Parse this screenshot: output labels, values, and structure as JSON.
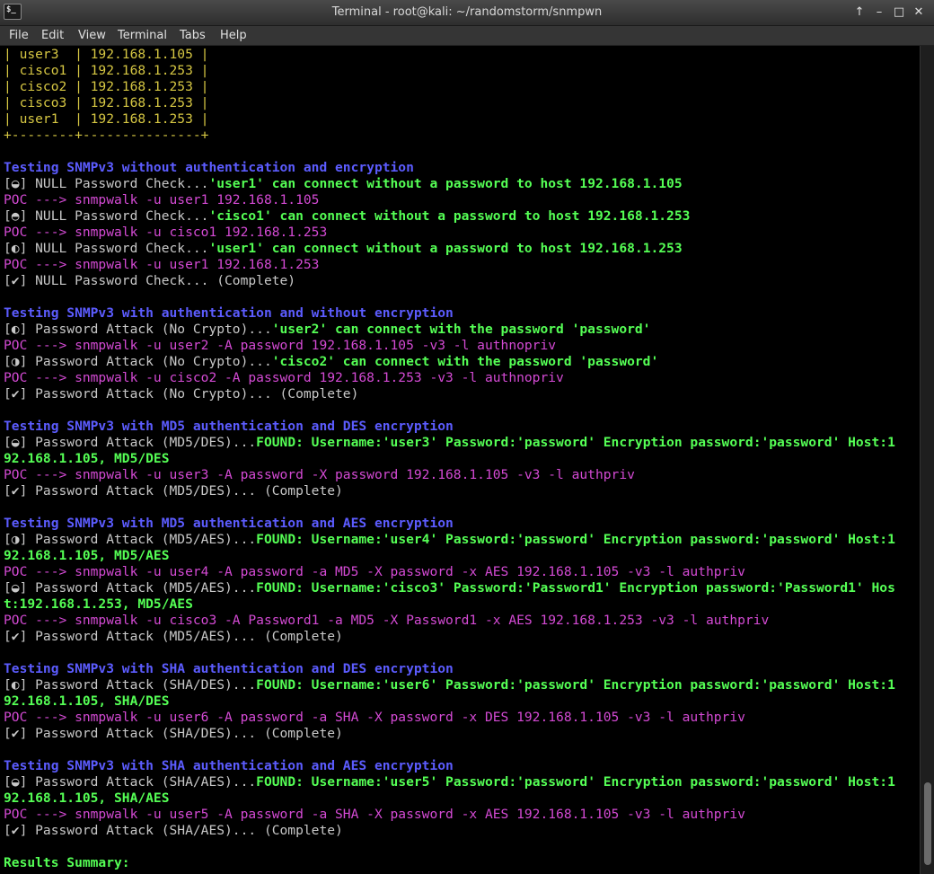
{
  "window": {
    "title": "Terminal - root@kali: ~/randomstorm/snmpwn",
    "icon_label": "$_",
    "buttons": {
      "up": "↑",
      "minimize": "–",
      "maximize": "□",
      "close": "✕"
    }
  },
  "menu": [
    "File",
    "Edit",
    "View",
    "Terminal",
    "Tabs",
    "Help"
  ],
  "terminal": {
    "lines": [
      [
        {
          "t": "| user3  | 192.168.1.105 |",
          "c": "y"
        }
      ],
      [
        {
          "t": "| cisco1 | 192.168.1.253 |",
          "c": "y"
        }
      ],
      [
        {
          "t": "| cisco2 | 192.168.1.253 |",
          "c": "y"
        }
      ],
      [
        {
          "t": "| cisco3 | 192.168.1.253 |",
          "c": "y"
        }
      ],
      [
        {
          "t": "| user1  | 192.168.1.253 |",
          "c": "y"
        }
      ],
      [
        {
          "t": "+--------+---------------+",
          "c": "y"
        }
      ],
      [],
      [
        {
          "t": "Testing SNMPv3 without authentication and encryption",
          "c": "b"
        }
      ],
      [
        {
          "t": "[◒] NULL Password Check...",
          "c": "w"
        },
        {
          "t": "'user1' can connect without a password to host 192.168.1.105",
          "c": "g"
        }
      ],
      [
        {
          "t": "POC ---> snmpwalk -u user1 192.168.1.105",
          "c": "m"
        }
      ],
      [
        {
          "t": "[◓] NULL Password Check...",
          "c": "w"
        },
        {
          "t": "'cisco1' can connect without a password to host 192.168.1.253",
          "c": "g"
        }
      ],
      [
        {
          "t": "POC ---> snmpwalk -u cisco1 192.168.1.253",
          "c": "m"
        }
      ],
      [
        {
          "t": "[◐] NULL Password Check...",
          "c": "w"
        },
        {
          "t": "'user1' can connect without a password to host 192.168.1.253",
          "c": "g"
        }
      ],
      [
        {
          "t": "POC ---> snmpwalk -u user1 192.168.1.253",
          "c": "m"
        }
      ],
      [
        {
          "t": "[✔] NULL Password Check... (Complete)",
          "c": "w"
        }
      ],
      [],
      [
        {
          "t": "Testing SNMPv3 with authentication and without encryption",
          "c": "b"
        }
      ],
      [
        {
          "t": "[◐] Password Attack (No Crypto)...",
          "c": "w"
        },
        {
          "t": "'user2' can connect with the password 'password'",
          "c": "g"
        }
      ],
      [
        {
          "t": "POC ---> snmpwalk -u user2 -A password 192.168.1.105 -v3 -l authnopriv",
          "c": "m"
        }
      ],
      [
        {
          "t": "[◑] Password Attack (No Crypto)...",
          "c": "w"
        },
        {
          "t": "'cisco2' can connect with the password 'password'",
          "c": "g"
        }
      ],
      [
        {
          "t": "POC ---> snmpwalk -u cisco2 -A password 192.168.1.253 -v3 -l authnopriv",
          "c": "m"
        }
      ],
      [
        {
          "t": "[✔] Password Attack (No Crypto)... (Complete)",
          "c": "w"
        }
      ],
      [],
      [
        {
          "t": "Testing SNMPv3 with MD5 authentication and DES encryption",
          "c": "b"
        }
      ],
      [
        {
          "t": "[◒] Password Attack (MD5/DES)...",
          "c": "w"
        },
        {
          "t": "FOUND: Username:'user3' Password:'password' Encryption password:'password' Host:1",
          "c": "g"
        }
      ],
      [
        {
          "t": "92.168.1.105, MD5/DES",
          "c": "g"
        }
      ],
      [
        {
          "t": "POC ---> snmpwalk -u user3 -A password -X password 192.168.1.105 -v3 -l authpriv",
          "c": "m"
        }
      ],
      [
        {
          "t": "[✔] Password Attack (MD5/DES)... (Complete)",
          "c": "w"
        }
      ],
      [],
      [
        {
          "t": "Testing SNMPv3 with MD5 authentication and AES encryption",
          "c": "b"
        }
      ],
      [
        {
          "t": "[◑] Password Attack (MD5/AES)...",
          "c": "w"
        },
        {
          "t": "FOUND: Username:'user4' Password:'password' Encryption password:'password' Host:1",
          "c": "g"
        }
      ],
      [
        {
          "t": "92.168.1.105, MD5/AES",
          "c": "g"
        }
      ],
      [
        {
          "t": "POC ---> snmpwalk -u user4 -A password -a MD5 -X password -x AES 192.168.1.105 -v3 -l authpriv",
          "c": "m"
        }
      ],
      [
        {
          "t": "[◒] Password Attack (MD5/AES)...",
          "c": "w"
        },
        {
          "t": "FOUND: Username:'cisco3' Password:'Password1' Encryption password:'Password1' Hos",
          "c": "g"
        }
      ],
      [
        {
          "t": "t:192.168.1.253, MD5/AES",
          "c": "g"
        }
      ],
      [
        {
          "t": "POC ---> snmpwalk -u cisco3 -A Password1 -a MD5 -X Password1 -x AES 192.168.1.253 -v3 -l authpriv",
          "c": "m"
        }
      ],
      [
        {
          "t": "[✔] Password Attack (MD5/AES)... (Complete)",
          "c": "w"
        }
      ],
      [],
      [
        {
          "t": "Testing SNMPv3 with SHA authentication and DES encryption",
          "c": "b"
        }
      ],
      [
        {
          "t": "[◐] Password Attack (SHA/DES)...",
          "c": "w"
        },
        {
          "t": "FOUND: Username:'user6' Password:'password' Encryption password:'password' Host:1",
          "c": "g"
        }
      ],
      [
        {
          "t": "92.168.1.105, SHA/DES",
          "c": "g"
        }
      ],
      [
        {
          "t": "POC ---> snmpwalk -u user6 -A password -a SHA -X password -x DES 192.168.1.105 -v3 -l authpriv",
          "c": "m"
        }
      ],
      [
        {
          "t": "[✔] Password Attack (SHA/DES)... (Complete)",
          "c": "w"
        }
      ],
      [],
      [
        {
          "t": "Testing SNMPv3 with SHA authentication and AES encryption",
          "c": "b"
        }
      ],
      [
        {
          "t": "[◒] Password Attack (SHA/AES)...",
          "c": "w"
        },
        {
          "t": "FOUND: Username:'user5' Password:'password' Encryption password:'password' Host:1",
          "c": "g"
        }
      ],
      [
        {
          "t": "92.168.1.105, SHA/AES",
          "c": "g"
        }
      ],
      [
        {
          "t": "POC ---> snmpwalk -u user5 -A password -a SHA -X password -x AES 192.168.1.105 -v3 -l authpriv",
          "c": "m"
        }
      ],
      [
        {
          "t": "[✔] Password Attack (SHA/AES)... (Complete)",
          "c": "w"
        }
      ],
      [],
      [
        {
          "t": "Results Summary:",
          "c": "g"
        }
      ]
    ]
  }
}
